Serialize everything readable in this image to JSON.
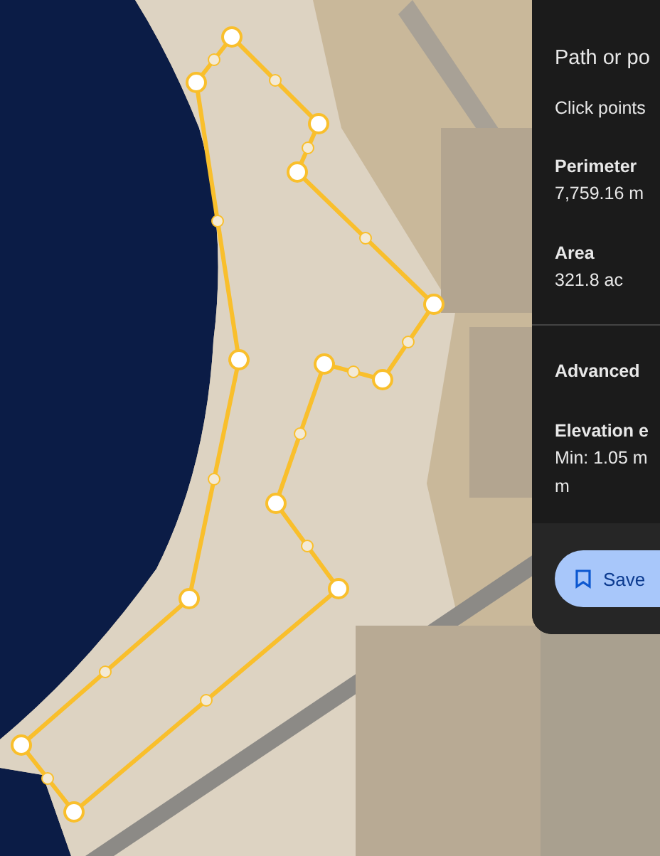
{
  "panel": {
    "title": "Path or po",
    "instructions": "Click points",
    "stats": [
      {
        "label": "Perimeter",
        "value": "7,759.16 m"
      },
      {
        "label": "Area",
        "value": "321.8 ac"
      }
    ],
    "advanced": {
      "label": "Advanced",
      "elevation_label": "Elevation e",
      "elevation_min": "Min: 1.05 m",
      "elevation_rest": "m"
    },
    "save_button": {
      "label": "Save"
    }
  }
}
